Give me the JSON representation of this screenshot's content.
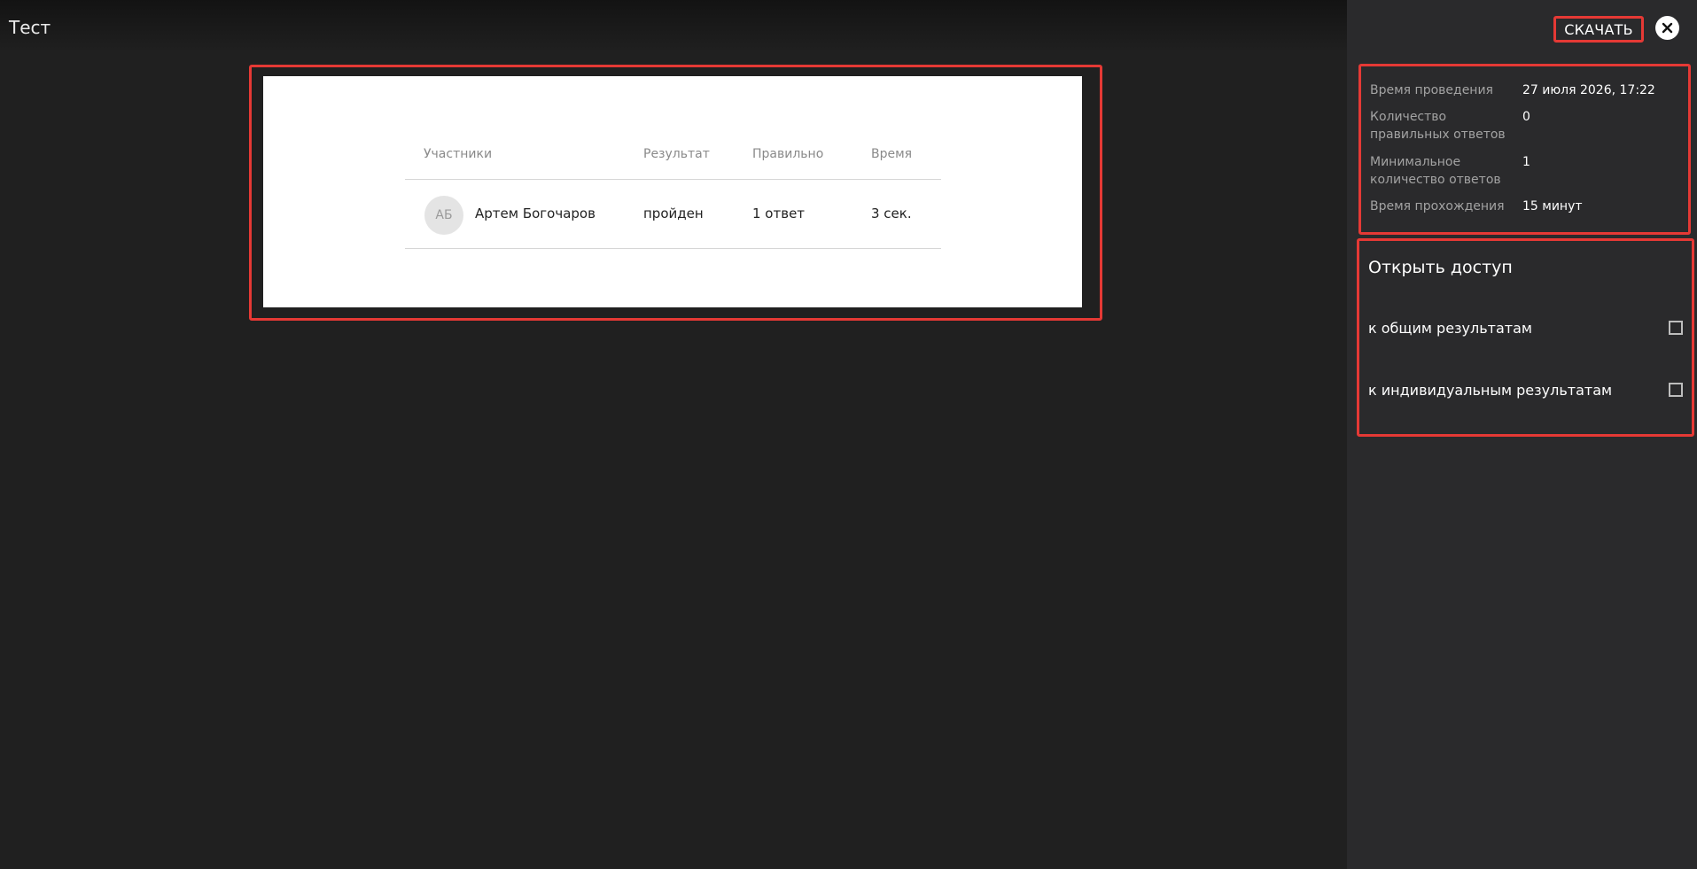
{
  "header": {
    "title": "Тест",
    "download_label": "СКАЧАТЬ"
  },
  "results": {
    "columns": [
      "Участники",
      "Результат",
      "Правильно",
      "Время"
    ],
    "rows": [
      {
        "initials": "АБ",
        "name": "Артем Богочаров",
        "result": "пройден",
        "correct": "1 ответ",
        "time": "3 сек."
      }
    ]
  },
  "info": [
    {
      "label": "Время проведения",
      "value": "27 июля 2026, 17:22"
    },
    {
      "label": "Количество правильных ответов",
      "value": "0"
    },
    {
      "label": "Минимальное количество ответов",
      "value": "1"
    },
    {
      "label": "Время прохождения",
      "value": "15 минут"
    }
  ],
  "access": {
    "title": "Открыть доступ",
    "options": [
      {
        "label": "к общим результатам",
        "checked": false
      },
      {
        "label": "к индивидуальным результатам",
        "checked": false
      }
    ]
  },
  "colors": {
    "highlight_border": "#e53935",
    "background": "#202020",
    "side_panel": "#2a2a2c"
  },
  "icons": {
    "close": "close-icon"
  }
}
